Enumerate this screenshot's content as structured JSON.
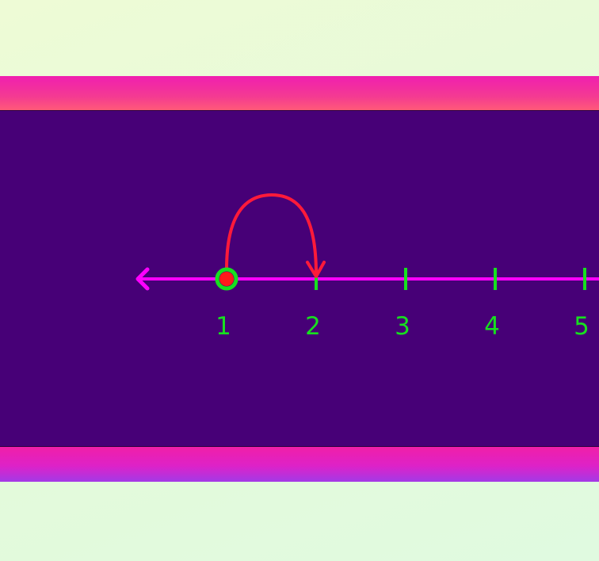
{
  "number_line": {
    "ticks": [
      {
        "label": "1"
      },
      {
        "label": "2"
      },
      {
        "label": "3"
      },
      {
        "label": "4"
      },
      {
        "label": "5"
      }
    ],
    "start_value": "1",
    "jump_size": 1,
    "colors": {
      "line": "#ff00ff",
      "ticks": "#17e01f",
      "start_dot": "#ff1a1a",
      "start_ring": "#17e01f",
      "jump_arrow": "#ff1a3a",
      "board": "#470077"
    }
  }
}
